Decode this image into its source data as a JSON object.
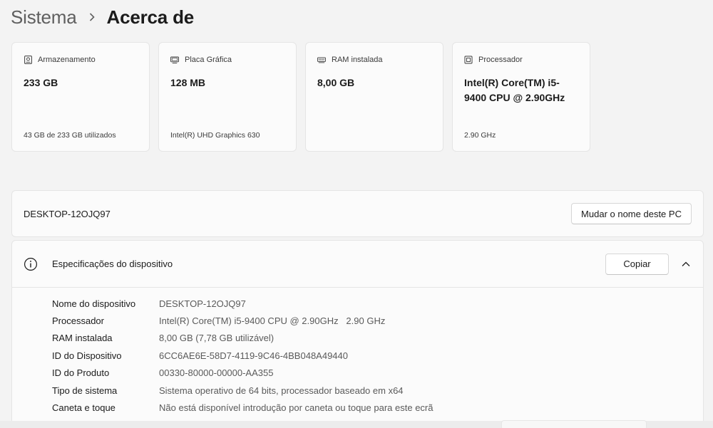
{
  "breadcrumb": {
    "parent": "Sistema",
    "separator_icon": "chevron-right-icon",
    "current": "Acerca de"
  },
  "cards": [
    {
      "icon": "storage-icon",
      "label": "Armazenamento",
      "value": "233 GB",
      "sub": "43 GB de 233 GB utilizados"
    },
    {
      "icon": "display-adapter-icon",
      "label": "Placa Gráfica",
      "value": "128 MB",
      "sub": "Intel(R) UHD Graphics 630"
    },
    {
      "icon": "ram-icon",
      "label": "RAM instalada",
      "value": "8,00 GB",
      "sub": ""
    },
    {
      "icon": "processor-icon",
      "label": "Processador",
      "value": "Intel(R) Core(TM) i5-9400 CPU @ 2.90GHz",
      "sub": "2.90 GHz"
    }
  ],
  "pc": {
    "name": "DESKTOP-12OJQ97",
    "rename_label": "Mudar o nome deste PC"
  },
  "specs": {
    "icon": "info-icon",
    "title": "Especificações do dispositivo",
    "copy_label": "Copiar",
    "collapse_icon": "chevron-up-icon",
    "rows": [
      {
        "key": "Nome do dispositivo",
        "value": "DESKTOP-12OJQ97"
      },
      {
        "key": "Processador",
        "value": "Intel(R) Core(TM) i5-9400 CPU @ 2.90GHz   2.90 GHz"
      },
      {
        "key": "RAM instalada",
        "value": "8,00 GB (7,78 GB utilizável)"
      },
      {
        "key": "ID do Dispositivo",
        "value": "6CC6AE6E-58D7-4119-9C46-4BB048A49440"
      },
      {
        "key": "ID do Produto",
        "value": "00330-80000-00000-AA355"
      },
      {
        "key": "Tipo de sistema",
        "value": "Sistema operativo de 64 bits, processador baseado em x64"
      },
      {
        "key": "Caneta e toque",
        "value": "Não está disponível introdução por caneta ou toque para este ecrã"
      }
    ]
  }
}
